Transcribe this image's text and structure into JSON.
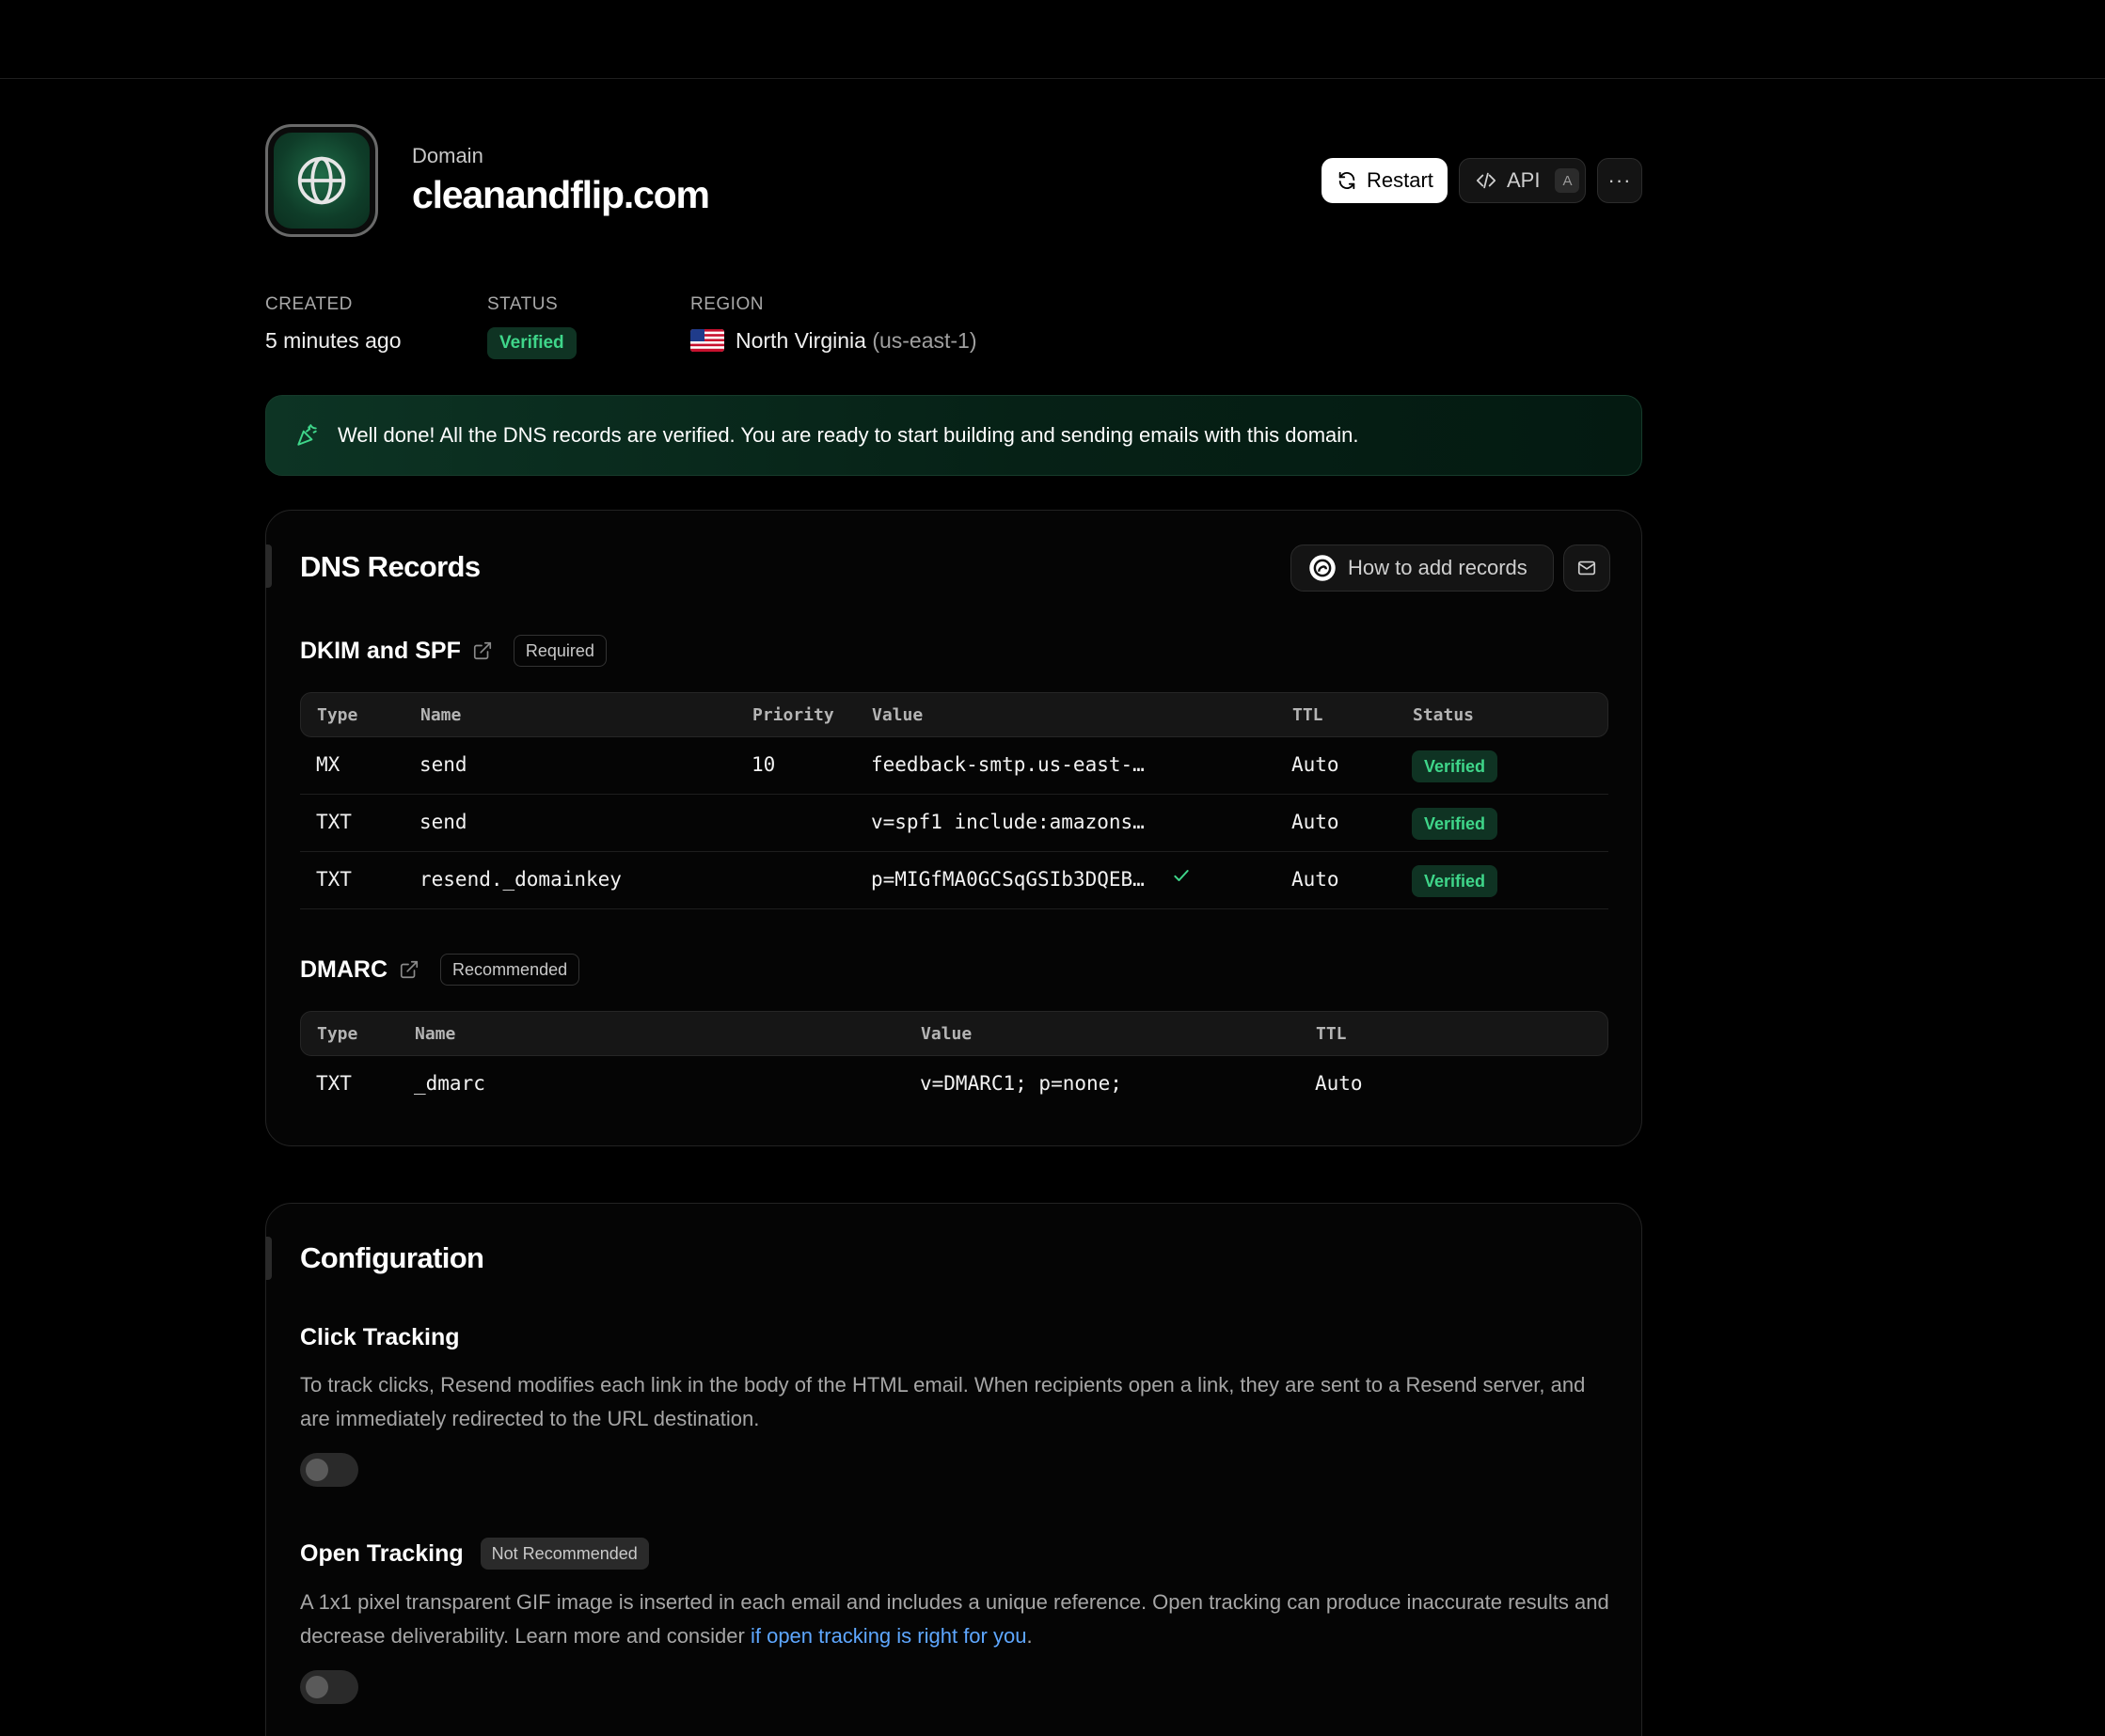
{
  "header": {
    "domain_label": "Domain",
    "domain_name": "cleanandflip.com",
    "actions": {
      "restart_label": "Restart",
      "api_label": "API",
      "api_shortcut": "A",
      "more_label": "···"
    }
  },
  "meta": {
    "created_label": "CREATED",
    "created_value": "5 minutes ago",
    "status_label": "STATUS",
    "status_value": "Verified",
    "region_label": "REGION",
    "region_name": "North Virginia",
    "region_code": "(us-east-1)"
  },
  "success_banner": {
    "text": "Well done! All the DNS records are verified. You are ready to start building and sending emails with this domain."
  },
  "dns": {
    "title": "DNS Records",
    "how_to_label": "How to add records",
    "dkim_section": {
      "title": "DKIM and SPF",
      "badge": "Required",
      "columns": [
        "Type",
        "Name",
        "Priority",
        "Value",
        "TTL",
        "Status"
      ],
      "rows": [
        {
          "type": "MX",
          "name": "send",
          "priority": "10",
          "value": "feedback-smtp.us-east-…",
          "ttl": "Auto",
          "status": "Verified"
        },
        {
          "type": "TXT",
          "name": "send",
          "priority": "",
          "value": "v=spf1 include:amazons…",
          "ttl": "Auto",
          "status": "Verified"
        },
        {
          "type": "TXT",
          "name": "resend._domainkey",
          "priority": "",
          "value": "p=MIGfMA0GCSqGSIb3DQEB…",
          "ttl": "Auto",
          "status": "Verified"
        }
      ]
    },
    "dmarc_section": {
      "title": "DMARC",
      "badge": "Recommended",
      "columns": [
        "Type",
        "Name",
        "Value",
        "TTL"
      ],
      "rows": [
        {
          "type": "TXT",
          "name": "_dmarc",
          "value": "v=DMARC1; p=none;",
          "ttl": "Auto"
        }
      ]
    }
  },
  "config": {
    "title": "Configuration",
    "click_tracking": {
      "title": "Click Tracking",
      "description": "To track clicks, Resend modifies each link in the body of the HTML email. When recipients open a link, they are sent to a Resend server, and are immediately redirected to the URL destination.",
      "enabled": false
    },
    "open_tracking": {
      "title": "Open Tracking",
      "badge": "Not Recommended",
      "description": "A 1x1 pixel transparent GIF image is inserted in each email and includes a unique reference. Open tracking can produce inaccurate results and decrease deliverability. Learn more and consider ",
      "link_text": "if open tracking is right for you",
      "description_end": ".",
      "enabled": false
    }
  },
  "colors": {
    "background": "#000000",
    "verified_text": "#3fd68a",
    "verified_bg": "#0f3323",
    "link": "#5ea7ff"
  }
}
